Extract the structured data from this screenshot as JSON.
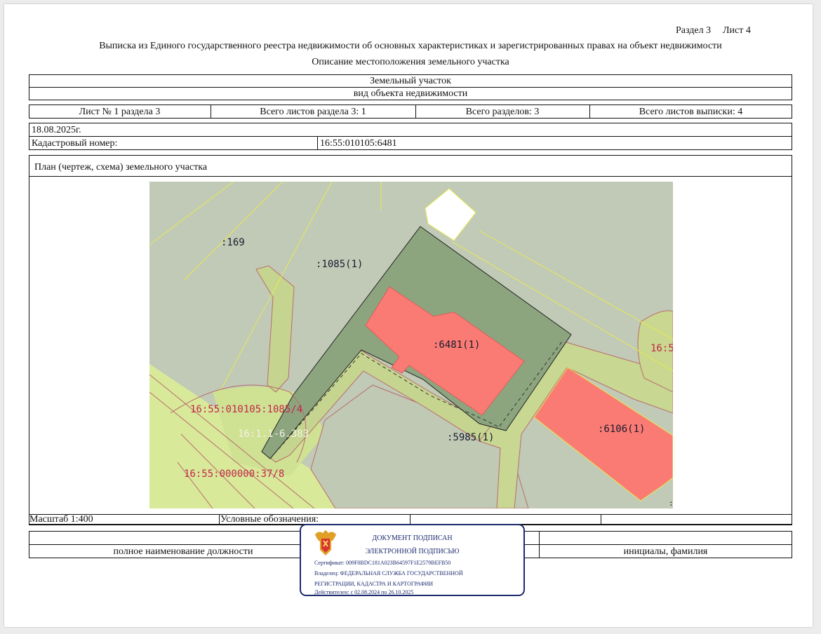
{
  "header": {
    "section": "Раздел 3",
    "sheet": "Лист 4",
    "title": "Выписка из Единого государственного реестра недвижимости об основных характеристиках и зарегистрированных правах на объект недвижимости",
    "subtitle": "Описание местоположения земельного участка"
  },
  "object": {
    "type": "Земельный участок",
    "type_caption": "вид объекта недвижимости"
  },
  "sheets_row": {
    "sheet_no": "Лист № 1 раздела 3",
    "sheets_in_section": "Всего листов раздела 3: 1",
    "sections_total": "Всего разделов: 3",
    "sheets_total": "Всего листов выписки: 4"
  },
  "info": {
    "date": "18.08.2025г.",
    "cad_label": "Кадастровый номер:",
    "cad_number": "16:55:010105:6481"
  },
  "plan": {
    "caption": "План (чертеж, схема) земельного участка",
    "labels": {
      "l169": ":169",
      "l1085": ":1085(1)",
      "l6481": ":6481(1)",
      "l6106": ":6106(1)",
      "l5985": ":5985(1)",
      "l1085_4": "16:55:010105:1085/4",
      "l6383": "16:1.1-6.383",
      "l37_8": "16:55:000000:37/8",
      "l16_5": "16:5",
      "lcolon": ":"
    }
  },
  "legend_row": {
    "scale": "Масштаб 1:400",
    "legend": "Условные обозначения:"
  },
  "signature_row": {
    "position": "полное наименование должности",
    "name": "инициалы, фамилия"
  },
  "stamp": {
    "line1": "ДОКУМЕНТ ПОДПИСАН",
    "line2": "ЭЛЕКТРОННОЙ ПОДПИСЬЮ",
    "certificate": "Сертификат: 009F0BDC181A023B64597F1E2579BEFB50",
    "owner1": "Владелец: ФЕДЕРАЛЬНАЯ СЛУЖБА ГОСУДАРСТВЕННОЙ",
    "owner2": "РЕГИСТРАЦИИ, КАДАСТРА И КАРТОГРАФИИ",
    "valid": "Действителен: с 02.08.2024 по 26.10.2025"
  },
  "colors": {
    "parcel_dark": "#8ca57f",
    "parcel_grey": "#bfc9b5",
    "building_red": "#fa7b73",
    "zone_green": "#dbe99a",
    "zone_olive": "#c3d48e",
    "stamp_blue": "#1b2a6e"
  }
}
